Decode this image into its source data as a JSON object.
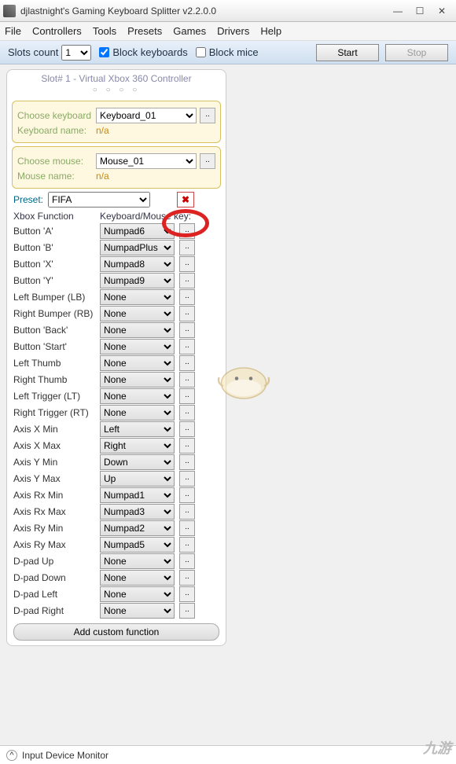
{
  "window": {
    "title": "djlastnight's Gaming Keyboard Splitter v2.2.0.0"
  },
  "menu": [
    "File",
    "Controllers",
    "Tools",
    "Presets",
    "Games",
    "Drivers",
    "Help"
  ],
  "toolbar": {
    "slots_label": "Slots count",
    "slots_value": "1",
    "block_kb": "Block keyboards",
    "block_mice": "Block mice",
    "start": "Start",
    "stop": "Stop"
  },
  "slot": {
    "title": "Slot# 1 - Virtual Xbox 360 Controller",
    "choose_kb": "Choose keyboard",
    "kb_value": "Keyboard_01",
    "kb_name_lbl": "Keyboard name:",
    "kb_name": "n/a",
    "choose_mouse": "Choose mouse:",
    "mouse_value": "Mouse_01",
    "mouse_name_lbl": "Mouse name:",
    "mouse_name": "n/a"
  },
  "preset": {
    "label": "Preset:",
    "value": "FIFA"
  },
  "columns": {
    "c1": "Xbox Function",
    "c2": "Keyboard/Mouse key:"
  },
  "mappings": [
    {
      "fn": "Button 'A'",
      "key": "Numpad6"
    },
    {
      "fn": "Button 'B'",
      "key": "NumpadPlus"
    },
    {
      "fn": "Button 'X'",
      "key": "Numpad8"
    },
    {
      "fn": "Button 'Y'",
      "key": "Numpad9"
    },
    {
      "fn": "Left Bumper (LB)",
      "key": "None"
    },
    {
      "fn": "Right Bumper (RB)",
      "key": "None"
    },
    {
      "fn": "Button 'Back'",
      "key": "None"
    },
    {
      "fn": "Button 'Start'",
      "key": "None"
    },
    {
      "fn": "Left Thumb",
      "key": "None"
    },
    {
      "fn": "Right Thumb",
      "key": "None"
    },
    {
      "fn": "Left Trigger (LT)",
      "key": "None"
    },
    {
      "fn": "Right Trigger (RT)",
      "key": "None"
    },
    {
      "fn": "Axis X Min",
      "key": "Left"
    },
    {
      "fn": "Axis X Max",
      "key": "Right"
    },
    {
      "fn": "Axis Y Min",
      "key": "Down"
    },
    {
      "fn": "Axis Y Max",
      "key": "Up"
    },
    {
      "fn": "Axis Rx Min",
      "key": "Numpad1"
    },
    {
      "fn": "Axis Rx Max",
      "key": "Numpad3"
    },
    {
      "fn": "Axis Ry Min",
      "key": "Numpad2"
    },
    {
      "fn": "Axis Ry Max",
      "key": "Numpad5"
    },
    {
      "fn": "D-pad Up",
      "key": "None"
    },
    {
      "fn": "D-pad Down",
      "key": "None"
    },
    {
      "fn": "D-pad Left",
      "key": "None"
    },
    {
      "fn": "D-pad Right",
      "key": "None"
    }
  ],
  "add_custom": "Add custom function",
  "status": "Input Device Monitor",
  "watermark": "九游"
}
